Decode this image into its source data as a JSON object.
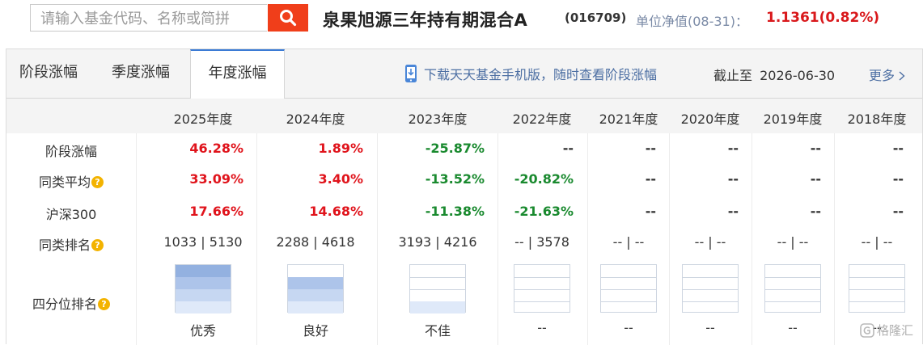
{
  "search": {
    "placeholder": "请输入基金代码、名称或简拼"
  },
  "fund": {
    "name": "泉果旭源三年持有期混合A",
    "code": "(016709)",
    "nav_label": "单位净值(08-31)：",
    "nav_value": "1.1361(0.82%)"
  },
  "tabs": [
    {
      "label": "阶段涨幅",
      "active": false
    },
    {
      "label": "季度涨幅",
      "active": false
    },
    {
      "label": "年度涨幅",
      "active": true
    }
  ],
  "app_link": {
    "label": "下载天天基金手机版，随时查看阶段涨幅",
    "icon": "mobile-phone-icon"
  },
  "deadline": {
    "label": "截止至",
    "date": "2026-06-30"
  },
  "more": {
    "label": "更多",
    "icon": "chevron-right-icon"
  },
  "table": {
    "years": [
      "2025年度",
      "2024年度",
      "2023年度",
      "2022年度",
      "2021年度",
      "2020年度",
      "2019年度",
      "2018年度"
    ],
    "rows": [
      {
        "label": "阶段涨幅",
        "help": false,
        "values": [
          "46.28%",
          "1.89%",
          "-25.87%",
          "--",
          "--",
          "--",
          "--",
          "--"
        ]
      },
      {
        "label": "同类平均",
        "help": true,
        "values": [
          "33.09%",
          "3.40%",
          "-13.52%",
          "-20.82%",
          "--",
          "--",
          "--",
          "--"
        ]
      },
      {
        "label": "沪深300",
        "help": false,
        "values": [
          "17.66%",
          "14.68%",
          "-11.38%",
          "-21.63%",
          "--",
          "--",
          "--",
          "--"
        ]
      },
      {
        "label": "同类排名",
        "help": true,
        "values": [
          "1033 | 5130",
          "2288 | 4618",
          "3193 | 4216",
          "-- | 3578",
          "-- | --",
          "-- | --",
          "-- | --",
          "-- | --"
        ]
      }
    ],
    "quartile": {
      "label": "四分位排名",
      "help": true,
      "levels": [
        4,
        3,
        1,
        0,
        0,
        0,
        0,
        0
      ],
      "texts": [
        "优秀",
        "良好",
        "不佳",
        "--",
        "--",
        "--",
        "--",
        "--"
      ]
    }
  },
  "colors": {
    "up": "#e0141c",
    "down": "#1a8a2f",
    "accent": "#f03e1a",
    "link": "#4d6fa3",
    "quart_fill": [
      "#93b1e0",
      "#adc4ea",
      "#c6d7f2",
      "#dfe9f9"
    ]
  },
  "watermark": "格隆汇"
}
